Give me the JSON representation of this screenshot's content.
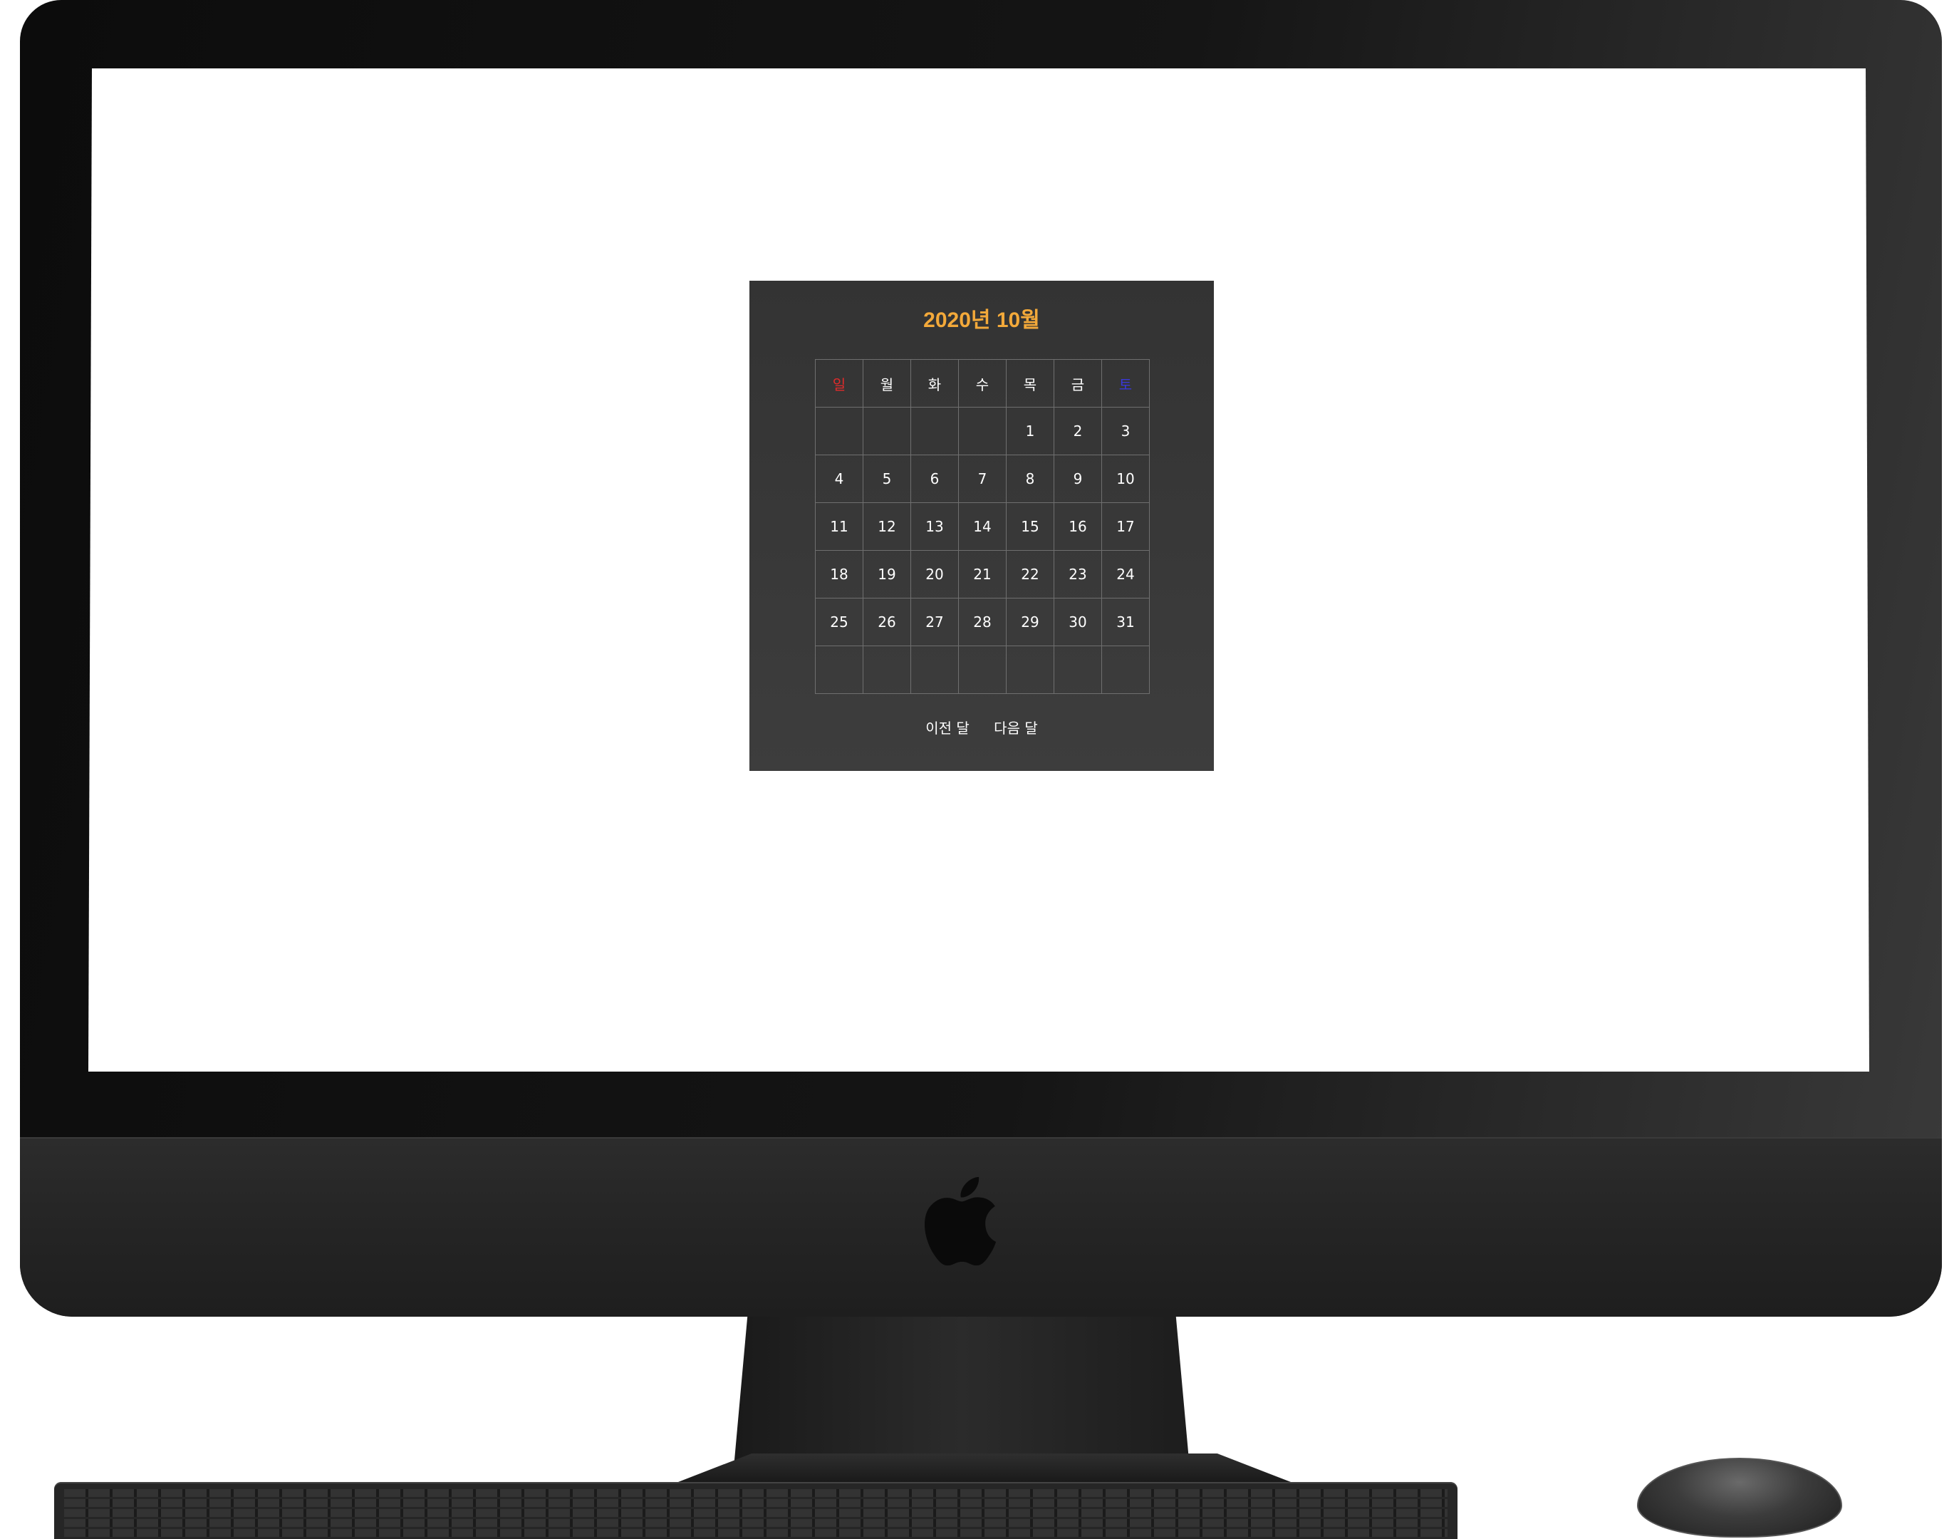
{
  "calendar": {
    "title": "2020년 10월",
    "weekdays": [
      "일",
      "월",
      "화",
      "수",
      "목",
      "금",
      "토"
    ],
    "weeks": [
      [
        "",
        "",
        "",
        "",
        "1",
        "2",
        "3"
      ],
      [
        "4",
        "5",
        "6",
        "7",
        "8",
        "9",
        "10"
      ],
      [
        "11",
        "12",
        "13",
        "14",
        "15",
        "16",
        "17"
      ],
      [
        "18",
        "19",
        "20",
        "21",
        "22",
        "23",
        "24"
      ],
      [
        "25",
        "26",
        "27",
        "28",
        "29",
        "30",
        "31"
      ],
      [
        "",
        "",
        "",
        "",
        "",
        "",
        ""
      ]
    ],
    "prev_label": "이전 달",
    "next_label": "다음 달"
  },
  "colors": {
    "title": "#f3a93a",
    "sunday": "#e02b2b",
    "saturday": "#3a38d8",
    "panel": "#3a3a3a"
  },
  "icons": {
    "brand": "apple-logo-icon"
  }
}
